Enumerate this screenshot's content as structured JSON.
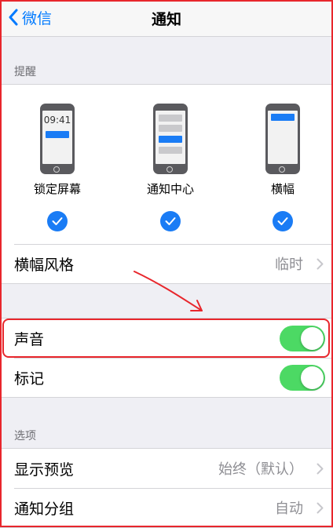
{
  "nav": {
    "back_label": "微信",
    "title": "通知"
  },
  "alerts": {
    "header": "提醒",
    "styles": [
      {
        "label": "锁定屏幕",
        "clock": "09:41",
        "checked": true
      },
      {
        "label": "通知中心",
        "checked": true
      },
      {
        "label": "横幅",
        "checked": true
      }
    ],
    "banner_style": {
      "label": "横幅风格",
      "value": "临时"
    }
  },
  "sound": {
    "label": "声音",
    "on": true
  },
  "badge": {
    "label": "标记",
    "on": true
  },
  "options": {
    "header": "选项",
    "show_preview": {
      "label": "显示预览",
      "value": "始终（默认）"
    },
    "grouping": {
      "label": "通知分组",
      "value": "自动"
    }
  },
  "colors": {
    "accent": "#007aff",
    "toggle_on": "#4cd964",
    "annotation": "#e8262c"
  }
}
